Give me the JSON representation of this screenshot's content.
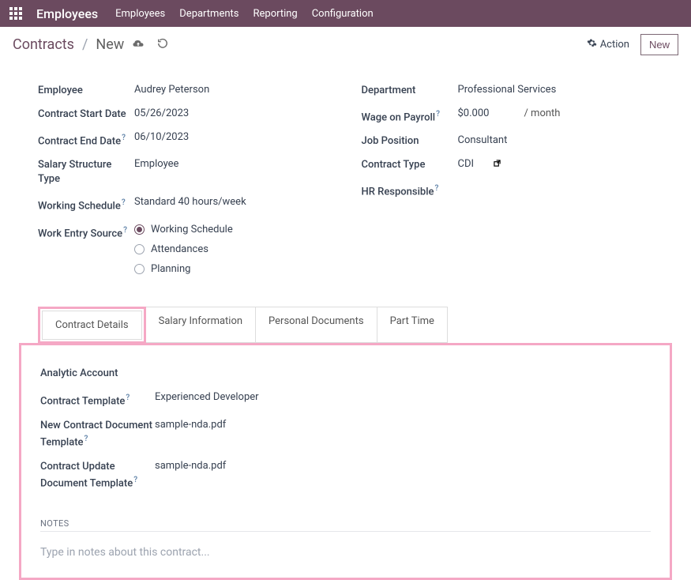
{
  "nav": {
    "appTitle": "Employees",
    "menus": [
      "Employees",
      "Departments",
      "Reporting",
      "Configuration"
    ]
  },
  "breadcrumb": {
    "root": "Contracts",
    "current": "New"
  },
  "actions": {
    "actionLabel": "Action",
    "newLabel": "New"
  },
  "form": {
    "left": {
      "employee": {
        "label": "Employee",
        "value": "Audrey Peterson"
      },
      "startDate": {
        "label": "Contract Start Date",
        "value": "05/26/2023"
      },
      "endDate": {
        "label": "Contract End Date",
        "value": "06/10/2023"
      },
      "salaryStruct": {
        "label": "Salary Structure Type",
        "value": "Employee"
      },
      "schedule": {
        "label": "Working Schedule",
        "value": "Standard 40 hours/week"
      },
      "workEntry": {
        "label": "Work Entry Source",
        "options": [
          "Working Schedule",
          "Attendances",
          "Planning"
        ],
        "selected": "Working Schedule"
      }
    },
    "right": {
      "department": {
        "label": "Department",
        "value": "Professional Services"
      },
      "wage": {
        "label": "Wage on Payroll",
        "value": "$0.000",
        "unit": "/ month"
      },
      "position": {
        "label": "Job Position",
        "value": "Consultant"
      },
      "contractType": {
        "label": "Contract Type",
        "value": "CDI"
      },
      "hrResp": {
        "label": "HR Responsible",
        "value": ""
      }
    }
  },
  "tabs": [
    "Contract Details",
    "Salary Information",
    "Personal Documents",
    "Part Time"
  ],
  "details": {
    "analytic": {
      "label": "Analytic Account",
      "value": ""
    },
    "template": {
      "label": "Contract Template",
      "value": "Experienced Developer"
    },
    "newDoc": {
      "label": "New Contract Document Template",
      "value": "sample-nda.pdf"
    },
    "updateDoc": {
      "label": "Contract Update Document Template",
      "value": "sample-nda.pdf"
    },
    "notesTitle": "NOTES",
    "notesPlaceholder": "Type in notes about this contract..."
  }
}
